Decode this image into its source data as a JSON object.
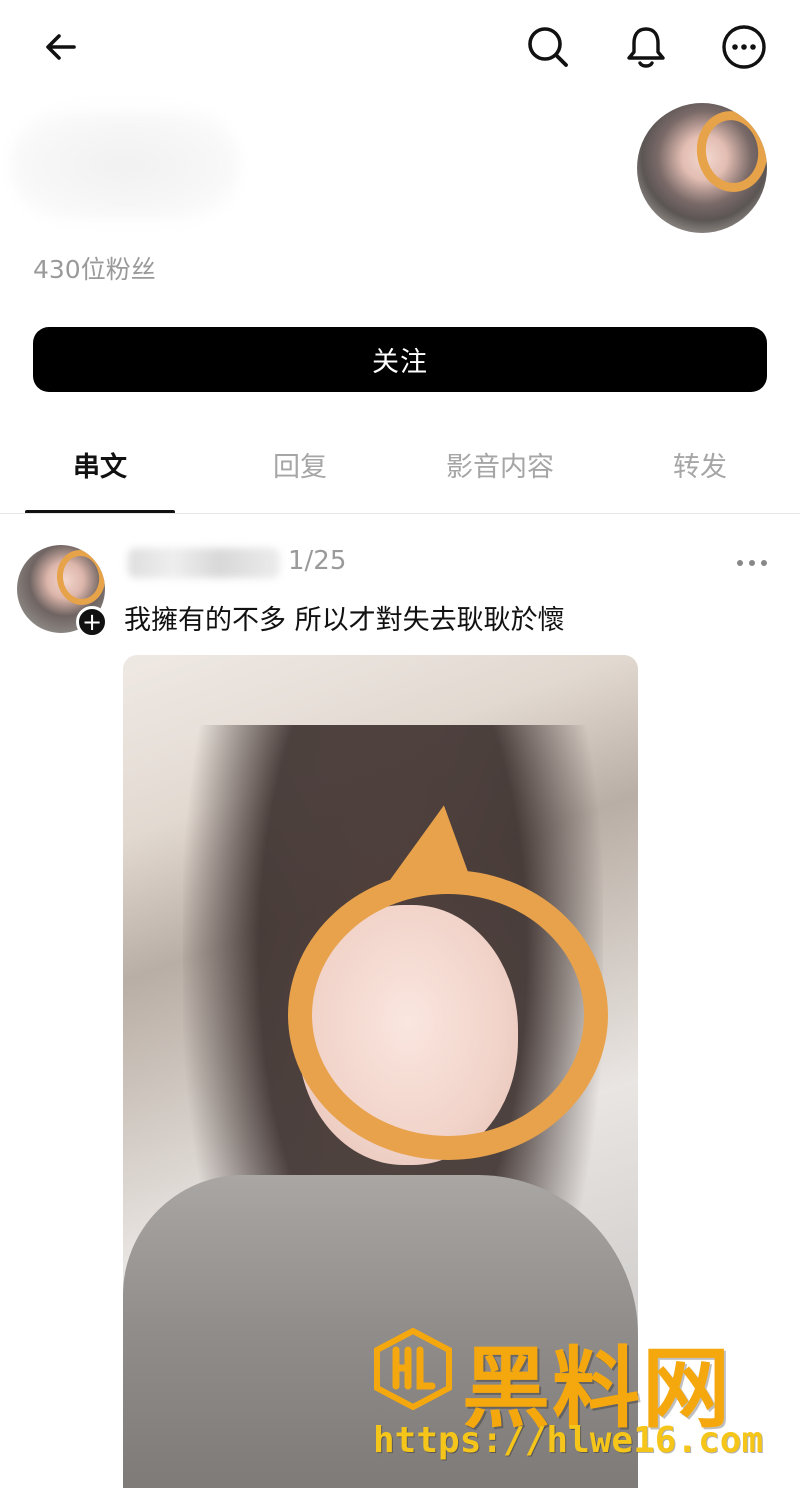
{
  "profile": {
    "followers": "430位粉丝",
    "follow_label": "关注"
  },
  "tabs": [
    {
      "label": "串文",
      "active": true
    },
    {
      "label": "回复",
      "active": false
    },
    {
      "label": "影音内容",
      "active": false
    },
    {
      "label": "转发",
      "active": false
    }
  ],
  "post": {
    "date": "1/25",
    "text": "我擁有的不多 所以才對失去耿耿於懷"
  },
  "watermark": {
    "brand": "黑料网",
    "url": "https://hlwe16.com"
  },
  "icons": {
    "back": "back-arrow-icon",
    "search": "search-icon",
    "notifications": "bell-icon",
    "more": "more-icon",
    "post_more": "more-horizontal-icon",
    "add": "plus-icon"
  },
  "colors": {
    "accent": "#000000",
    "muted_text": "#9a9a9a",
    "watermark": "#f5a80e"
  }
}
